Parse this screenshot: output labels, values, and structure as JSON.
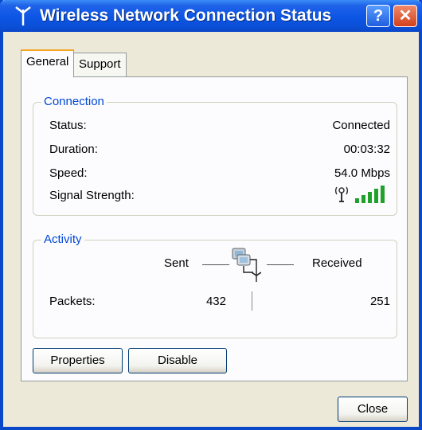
{
  "window": {
    "title": "Wireless Network Connection Status",
    "help_label": "?",
    "close_label": "✕"
  },
  "tabs": [
    {
      "label": "General"
    },
    {
      "label": "Support"
    }
  ],
  "connection": {
    "group_label": "Connection",
    "rows": [
      {
        "label": "Status:",
        "value": "Connected"
      },
      {
        "label": "Duration:",
        "value": "00:03:32"
      },
      {
        "label": "Speed:",
        "value": "54.0 Mbps"
      },
      {
        "label": "Signal Strength:"
      }
    ],
    "signal_bars_lit": 5,
    "signal_bars_total": 5,
    "signal_color": "#1fa12c"
  },
  "activity": {
    "group_label": "Activity",
    "sent_label": "Sent",
    "received_label": "Received",
    "packets_label": "Packets:",
    "packets_sent": "432",
    "packets_received": "251"
  },
  "buttons": {
    "properties": "Properties",
    "disable": "Disable",
    "close": "Close"
  },
  "colors": {
    "titlebar": "#0c55e4",
    "group_title": "#0046d5",
    "active_tab_accent": "#f5a623"
  }
}
